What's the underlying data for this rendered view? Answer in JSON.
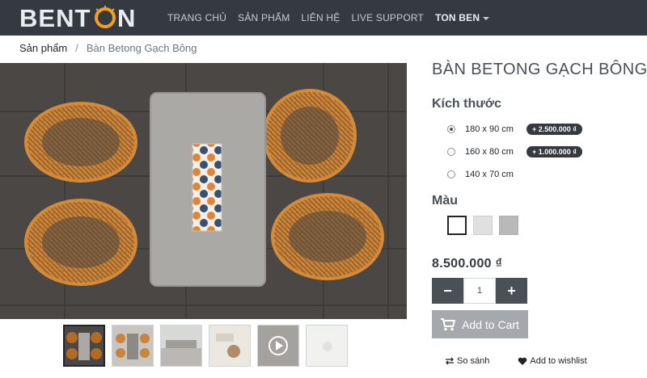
{
  "brand": {
    "logo_text": "BENTON"
  },
  "nav": {
    "items": [
      "TRANG CHỦ",
      "SẢN PHẨM",
      "LIÊN HỆ",
      "LIVE SUPPORT"
    ],
    "user": "TON BEN"
  },
  "breadcrumb": {
    "parent": "Sản phẩm",
    "separator": "/",
    "current": "Bàn Betong Gạch Bông"
  },
  "product": {
    "title": "BÀN BETONG GẠCH BÔNG",
    "size_label": "Kích thước",
    "sizes": [
      {
        "label": "180 x 90 cm",
        "badge": "+ 2.500.000 ₫",
        "checked": true
      },
      {
        "label": "160 x 80 cm",
        "badge": "+ 1.000.000 ₫",
        "checked": false
      },
      {
        "label": "140 x 70 cm",
        "badge": "",
        "checked": false
      }
    ],
    "color_label": "Màu",
    "colors": [
      "#ffffff",
      "#e0e0e0",
      "#b9b9b9"
    ],
    "price": "8.500.000 ₫",
    "quantity": "1",
    "minus": "−",
    "plus": "+",
    "add_to_cart": "Add to Cart",
    "compare": "So sánh",
    "wishlist": "Add to wishlist"
  },
  "thumbnail_count": 6,
  "colors": {
    "navbar": "#343a40",
    "chair": "#c47a2f",
    "table": "#a9a8a4",
    "floor": "#4a4744"
  }
}
